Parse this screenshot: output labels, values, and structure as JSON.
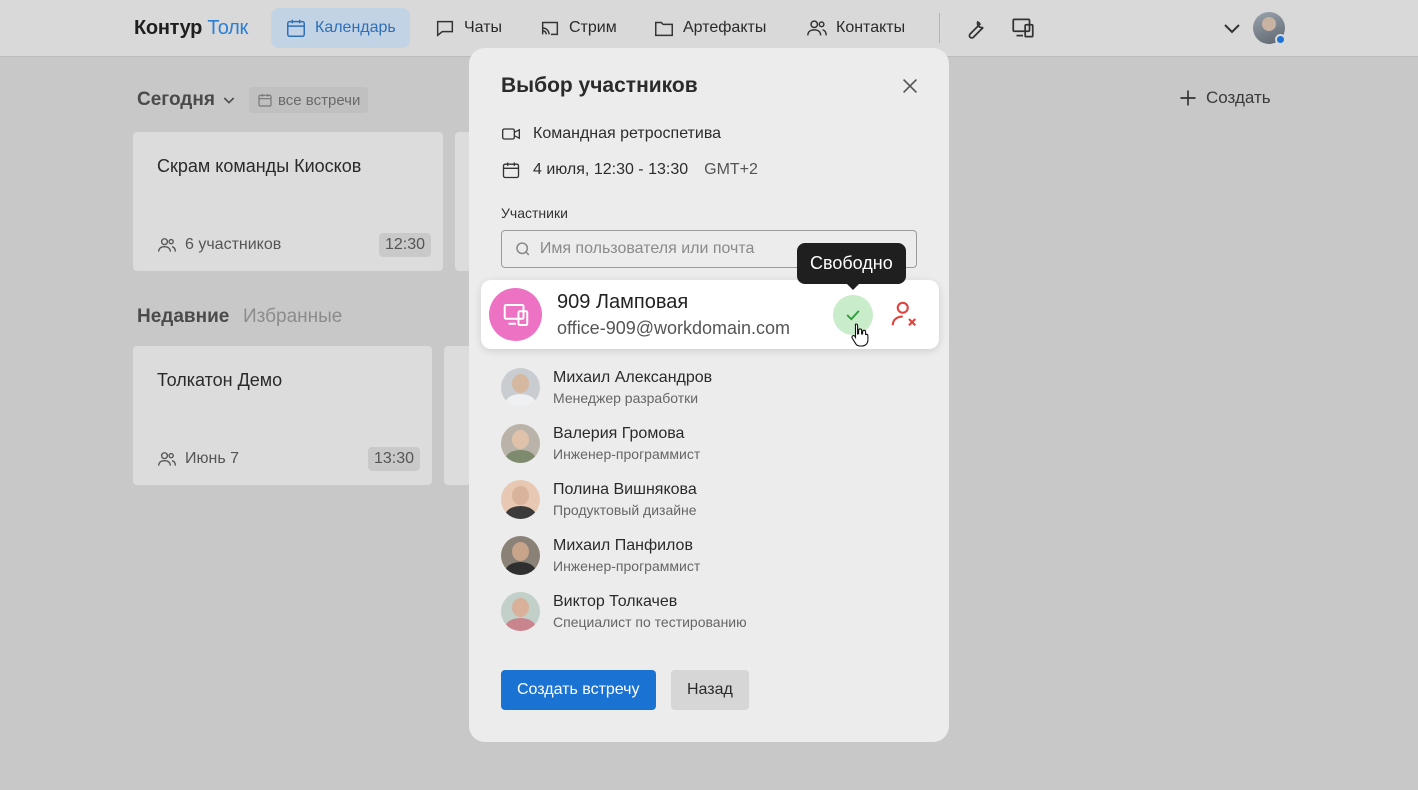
{
  "topbar": {
    "logo_main": "Контур",
    "logo_accent": "Толк",
    "nav": [
      {
        "label": "Календарь",
        "icon": "calendar-icon",
        "active": true
      },
      {
        "label": "Чаты",
        "icon": "chat-icon"
      },
      {
        "label": "Стрим",
        "icon": "stream-icon"
      },
      {
        "label": "Артефакты",
        "icon": "folder-icon"
      },
      {
        "label": "Контакты",
        "icon": "contacts-icon"
      }
    ],
    "status_color": "#1e73d8"
  },
  "background": {
    "today_label": "Сегодня",
    "all_meetings_chip": "все встречи",
    "create_label": "Создать",
    "today_card": {
      "title": "Скрам команды Киосков",
      "meta": "6 участников",
      "time": "12:30"
    },
    "recent_tab": "Недавние",
    "favorites_tab": "Избранные",
    "recent_card": {
      "title": "Толкатон Демо",
      "meta": "Июнь 7",
      "time": "13:30"
    }
  },
  "modal": {
    "title": "Выбор участников",
    "meeting_name": "Командная ретроспетива",
    "meeting_time": "4 июля, 12:30 - 13:30",
    "meeting_tz": "GMT+2",
    "participants_label": "Участники",
    "search_placeholder": "Имя пользователя или почта",
    "suggestion": {
      "name": "909 Ламповая",
      "email": "office-909@workdomain.com",
      "tooltip": "Свободно",
      "avatar_color": "#ee72c4"
    },
    "people": [
      {
        "name": "Михаил Александров",
        "role": "Менеджер разработки"
      },
      {
        "name": "Валерия Громова",
        "role": "Инженер-программист"
      },
      {
        "name": "Полина Вишнякова",
        "role": "Продуктовый дизайне"
      },
      {
        "name": "Михаил Панфилов",
        "role": "Инженер-программист"
      },
      {
        "name": "Виктор Толкачев",
        "role": "Специалист по тестированию"
      }
    ],
    "primary_button": "Создать встречу",
    "secondary_button": "Назад",
    "accent_color": "#1a73d2"
  }
}
